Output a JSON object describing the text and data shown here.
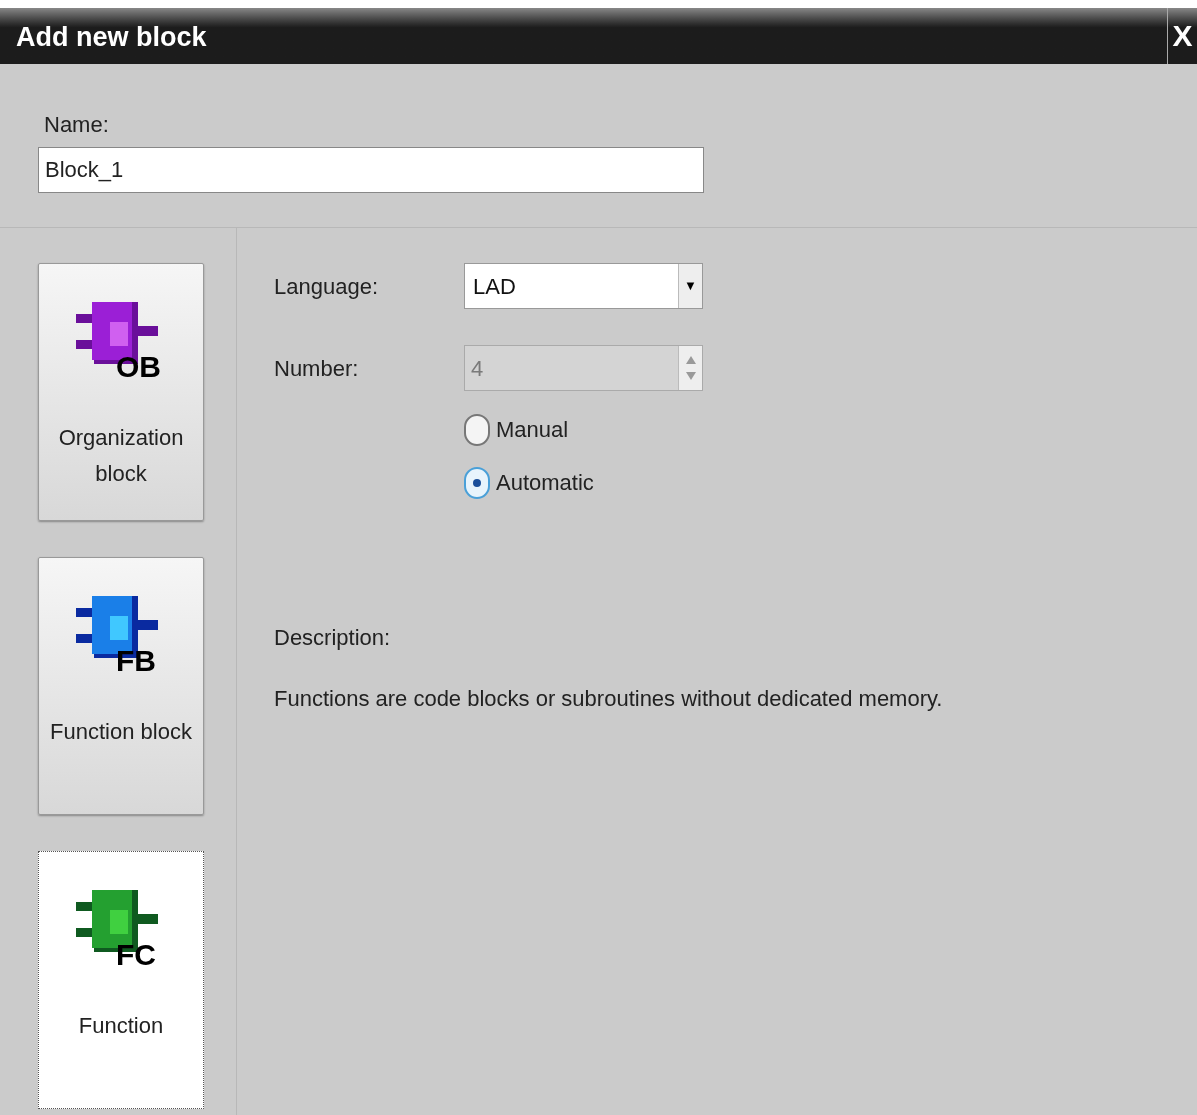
{
  "window": {
    "title": "Add new block",
    "close": "X"
  },
  "name_field": {
    "label": "Name:",
    "value": "Block_1"
  },
  "block_types": [
    {
      "kind": "ob",
      "code": "OB",
      "label": "Organization block",
      "color": "#9b1fd6",
      "selected": false
    },
    {
      "kind": "fb",
      "code": "FB",
      "label": "Function block",
      "color": "#1a7fe8",
      "selected": false
    },
    {
      "kind": "fc",
      "code": "FC",
      "label": "Function",
      "color": "#24a030",
      "selected": true
    }
  ],
  "language": {
    "label": "Language:",
    "value": "LAD",
    "arrow": "▼"
  },
  "number": {
    "label": "Number:",
    "value": "4",
    "disabled": true
  },
  "numbering": [
    {
      "label": "Manual",
      "selected": false
    },
    {
      "label": "Automatic",
      "selected": true
    }
  ],
  "description": {
    "label": "Description:",
    "text": "Functions are code blocks or subroutines without dedicated memory."
  }
}
